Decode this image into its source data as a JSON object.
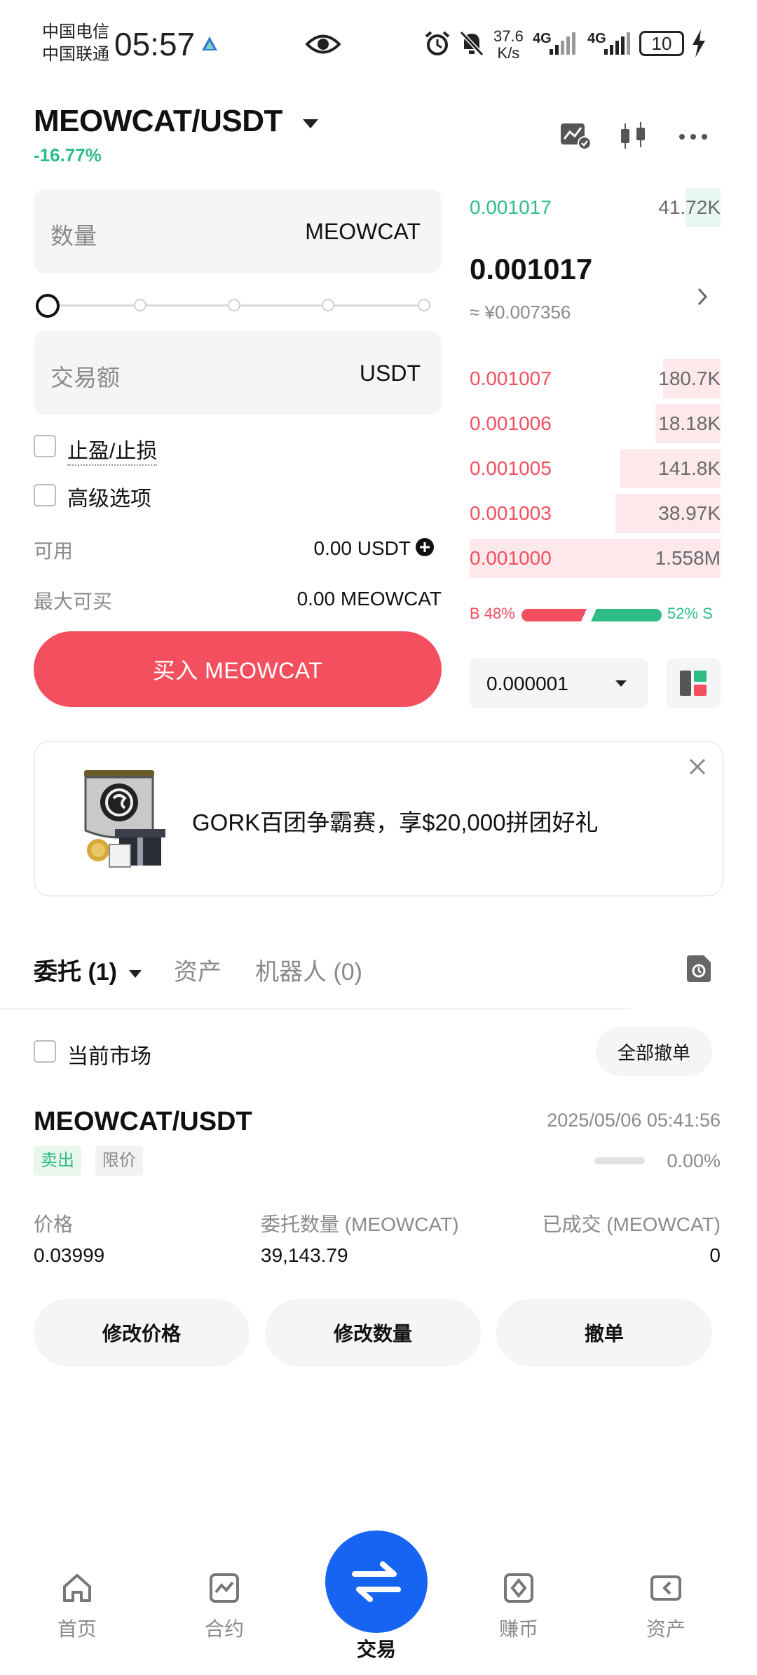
{
  "status_bar": {
    "carrier1": "中国电信",
    "carrier2": "中国联通",
    "time": "05:57",
    "net_speed_value": "37.6",
    "net_speed_unit": "K/s",
    "signal1": "4G",
    "signal2": "4G",
    "battery": "10"
  },
  "header": {
    "pair": "MEOWCAT/USDT",
    "change": "-16.77%"
  },
  "order_form": {
    "amount_placeholder": "数量",
    "amount_unit": "MEOWCAT",
    "slider_fraction": 0,
    "total_placeholder": "交易额",
    "total_unit": "USDT",
    "tp_sl_label": "止盈/止损",
    "advanced_label": "高级选项",
    "available_label": "可用",
    "available_value": "0.00 USDT",
    "max_buy_label": "最大可买",
    "max_buy_value": "0.00 MEOWCAT",
    "buy_button": "买入 MEOWCAT"
  },
  "order_book": {
    "top_row": {
      "price": "0.001017",
      "qty": "41.72K",
      "depth": 0.14
    },
    "last_price": "0.001017",
    "last_price_cny": "≈ ¥0.007356",
    "bids": [
      {
        "price": "0.001007",
        "qty": "180.7K",
        "depth": 0.23
      },
      {
        "price": "0.001006",
        "qty": "18.18K",
        "depth": 0.26
      },
      {
        "price": "0.001005",
        "qty": "141.8K",
        "depth": 0.4
      },
      {
        "price": "0.001003",
        "qty": "38.97K",
        "depth": 0.42
      },
      {
        "price": "0.001000",
        "qty": "1.558M",
        "depth": 1.0
      }
    ],
    "buy_ratio_label": "B 48%",
    "sell_ratio_label": "52% S",
    "buy_ratio": 0.48,
    "precision": "0.000001"
  },
  "banner": {
    "text": "GORK百团争霸赛，享$20,000拼团好礼"
  },
  "tabs": {
    "orders": "委托 (1)",
    "assets": "资产",
    "bots": "机器人 (0)"
  },
  "filter": {
    "current_market": "当前市场",
    "cancel_all": "全部撤单"
  },
  "order": {
    "pair": "MEOWCAT/USDT",
    "time": "2025/05/06 05:41:56",
    "side": "卖出",
    "type": "限价",
    "filled_pct": "0.00%",
    "filled_fraction": 0,
    "price_label": "价格",
    "price": "0.03999",
    "qty_label": "委托数量 (MEOWCAT)",
    "qty": "39,143.79",
    "filled_label": "已成交 (MEOWCAT)",
    "filled": "0",
    "modify_price": "修改价格",
    "modify_qty": "修改数量",
    "cancel": "撤单"
  },
  "nav": {
    "home": "首页",
    "futures": "合约",
    "trade": "交易",
    "earn": "赚币",
    "assets": "资产"
  },
  "colors": {
    "buy_red": "#f34f5f",
    "sell_green": "#2ebd85",
    "accent_blue": "#1764f2"
  }
}
